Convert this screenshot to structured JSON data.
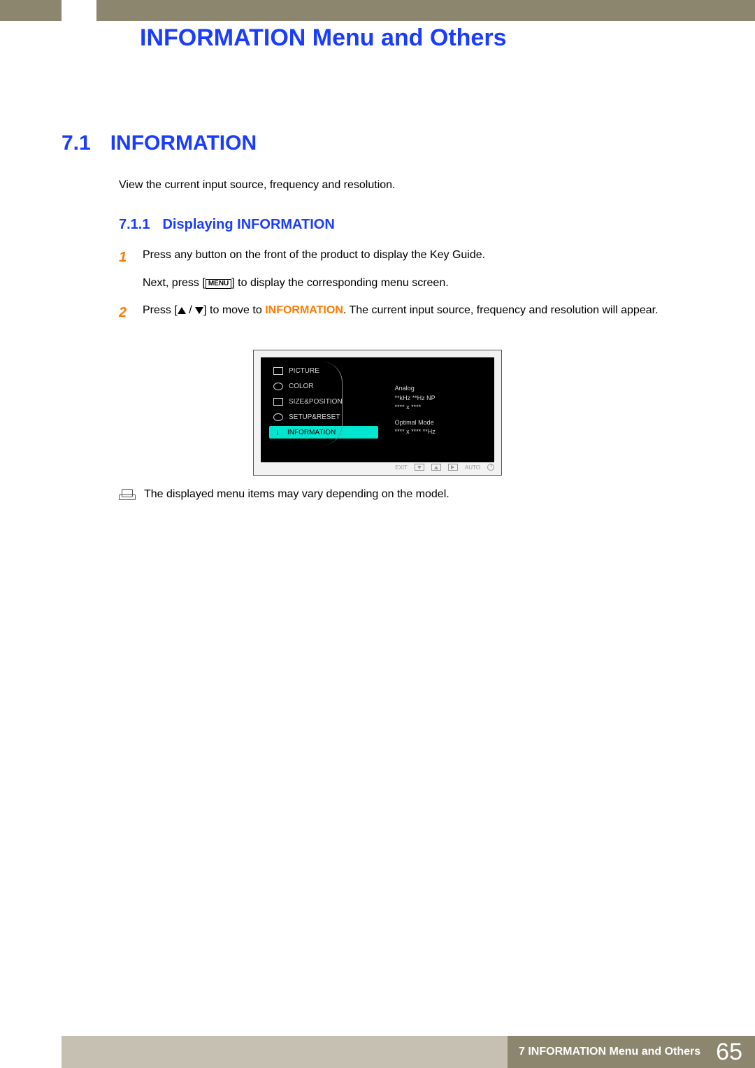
{
  "header": {
    "chapter_title": "INFORMATION Menu and Others"
  },
  "section": {
    "number": "7.1",
    "title": "INFORMATION",
    "intro": "View the current input source, frequency and resolution."
  },
  "subsection": {
    "number": "7.1.1",
    "title": "Displaying INFORMATION"
  },
  "steps": {
    "s1_num": "1",
    "s1_line1": "Press any button on the front of the product to display the Key Guide.",
    "s1_line2a": "Next, press [",
    "s1_menu": "MENU",
    "s1_line2b": "] to display the corresponding menu screen.",
    "s2_num": "2",
    "s2_a": "Press [",
    "s2_b": "] to move to ",
    "s2_kw": "INFORMATION",
    "s2_c": ". The current input source, frequency and resolution will appear."
  },
  "osd": {
    "items": [
      "PICTURE",
      "COLOR",
      "SIZE&POSITION",
      "SETUP&RESET",
      "INFORMATION"
    ],
    "right_lines": [
      "Analog",
      "**kHz **Hz NP",
      "**** x ****",
      "Optimal Mode",
      "**** x ****  **Hz"
    ],
    "bottom": {
      "exit": "EXIT",
      "auto": "AUTO"
    }
  },
  "note": "The displayed menu items may vary depending on the model.",
  "footer": {
    "text": "7 INFORMATION Menu and Others",
    "page": "65"
  }
}
